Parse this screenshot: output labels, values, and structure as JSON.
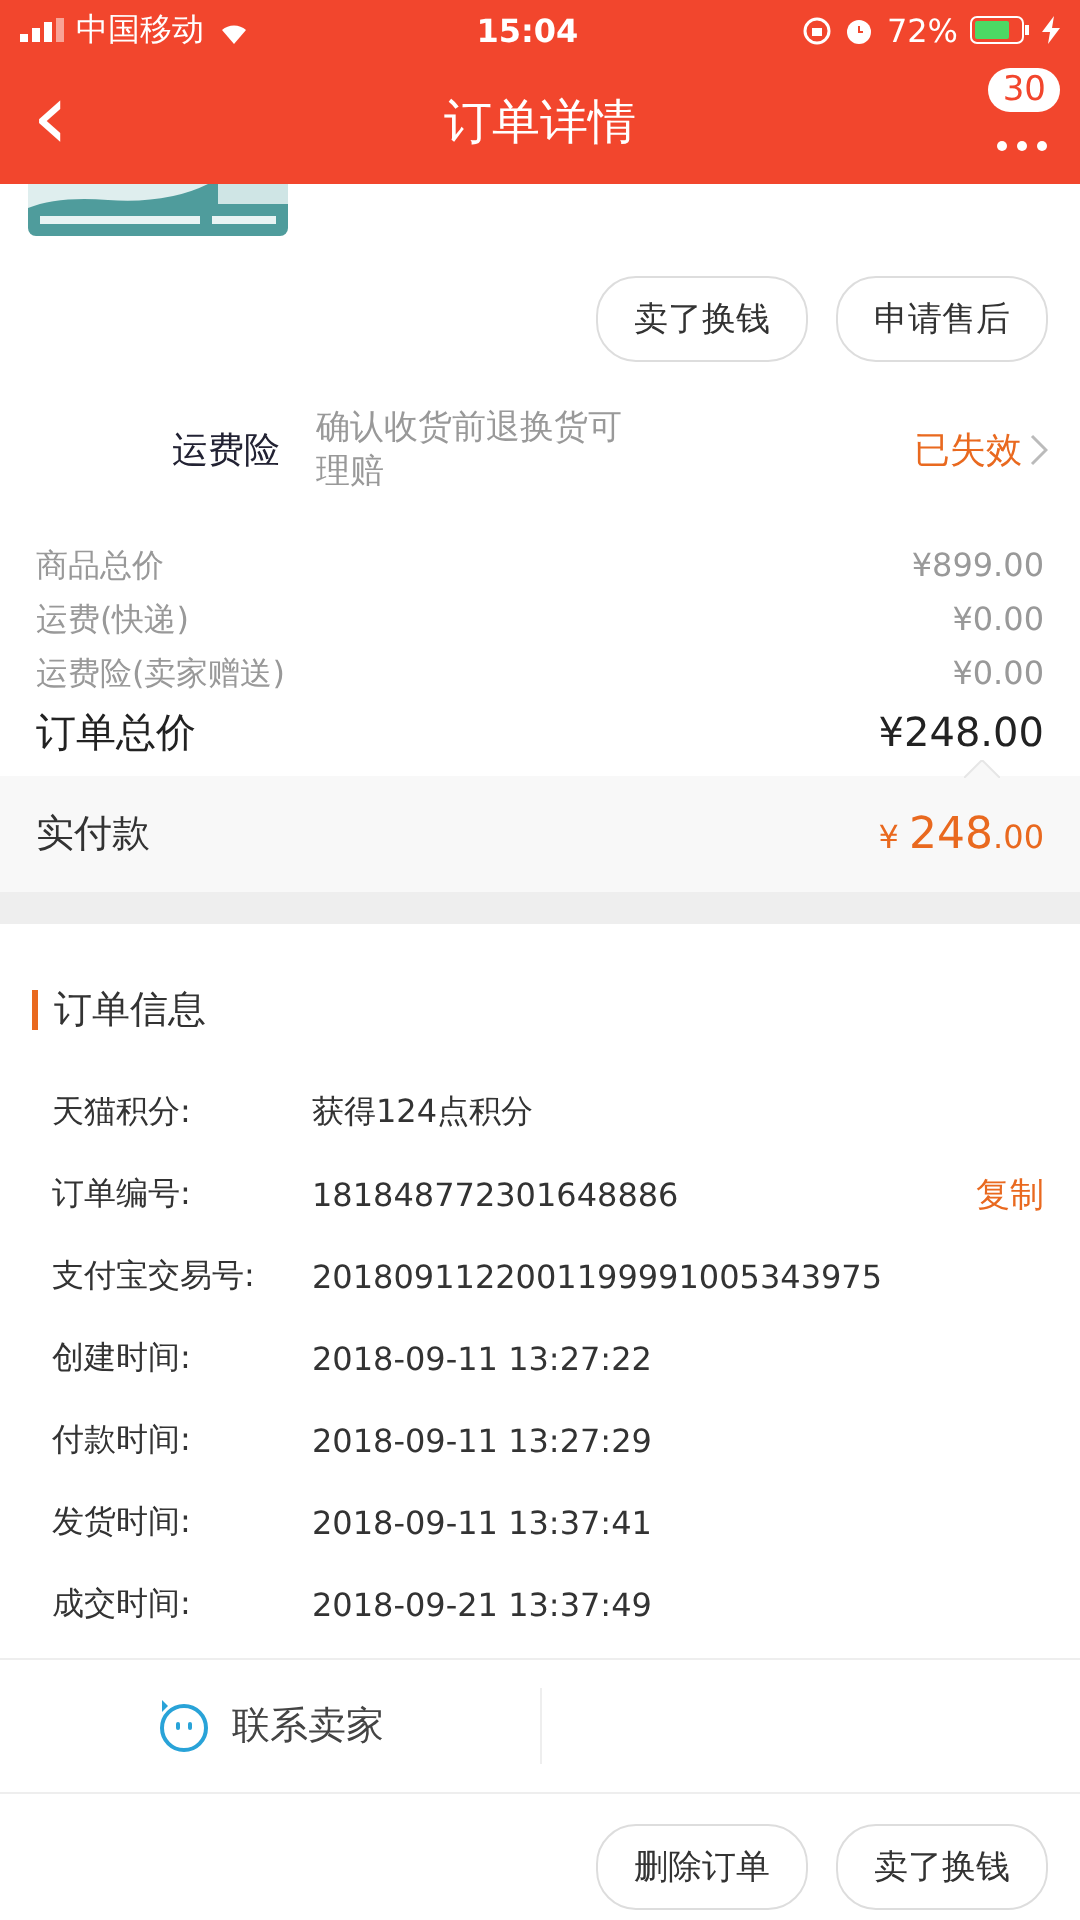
{
  "status_bar": {
    "carrier": "中国移动",
    "time": "15:04",
    "battery": "72%"
  },
  "nav": {
    "back": "‹",
    "title": "订单详情",
    "badge": "30"
  },
  "product": {
    "kind": "picture"
  },
  "top_buttons": [
    "卖了换钱",
    "申请售后"
  ],
  "insurance": {
    "label": "运费险",
    "desc": "确认收货前退换货可理赔",
    "status": "已失效"
  },
  "price_rows": [
    {
      "label": "商品总价",
      "value": "¥899.00"
    },
    {
      "label": "运费(快递)",
      "value": "¥0.00"
    },
    {
      "label": "运费险(卖家赠送)",
      "value": "¥0.00"
    }
  ],
  "order_total": {
    "label": "订单总价",
    "value": "¥248.00"
  },
  "paid": {
    "label": "实付款",
    "currency": "¥",
    "integer": "248",
    "decimal": ".00"
  },
  "order_info": {
    "title": "订单信息",
    "rows": [
      {
        "label": "天猫积分:",
        "value": "获得124点积分"
      },
      {
        "label": "订单编号:",
        "value": "181848772301648886",
        "action": "复制"
      },
      {
        "label": "支付宝交易号:",
        "value": "2018091122001199991005343975"
      },
      {
        "label": "创建时间:",
        "value": "2018-09-11 13:27:22"
      },
      {
        "label": "付款时间:",
        "value": "2018-09-11 13:27:29"
      },
      {
        "label": "发货时间:",
        "value": "2018-09-11 13:37:41"
      },
      {
        "label": "成交时间:",
        "value": "2018-09-21 13:37:49"
      }
    ]
  },
  "contact": {
    "label": "联系卖家"
  },
  "bottom_buttons": [
    "删除订单",
    "卖了换钱"
  ]
}
